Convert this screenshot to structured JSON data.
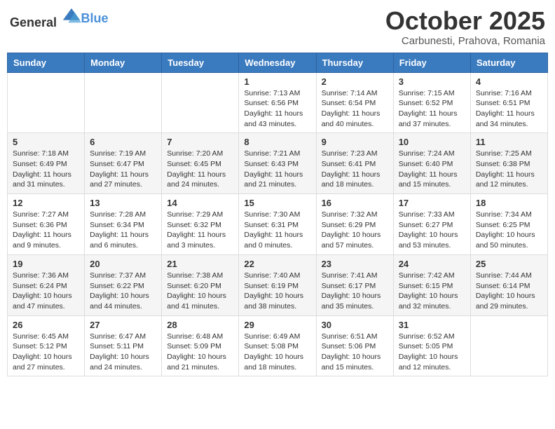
{
  "header": {
    "logo_general": "General",
    "logo_blue": "Blue",
    "month": "October 2025",
    "location": "Carbunesti, Prahova, Romania"
  },
  "days_of_week": [
    "Sunday",
    "Monday",
    "Tuesday",
    "Wednesday",
    "Thursday",
    "Friday",
    "Saturday"
  ],
  "weeks": [
    [
      {
        "day": "",
        "info": ""
      },
      {
        "day": "",
        "info": ""
      },
      {
        "day": "",
        "info": ""
      },
      {
        "day": "1",
        "info": "Sunrise: 7:13 AM\nSunset: 6:56 PM\nDaylight: 11 hours and 43 minutes."
      },
      {
        "day": "2",
        "info": "Sunrise: 7:14 AM\nSunset: 6:54 PM\nDaylight: 11 hours and 40 minutes."
      },
      {
        "day": "3",
        "info": "Sunrise: 7:15 AM\nSunset: 6:52 PM\nDaylight: 11 hours and 37 minutes."
      },
      {
        "day": "4",
        "info": "Sunrise: 7:16 AM\nSunset: 6:51 PM\nDaylight: 11 hours and 34 minutes."
      }
    ],
    [
      {
        "day": "5",
        "info": "Sunrise: 7:18 AM\nSunset: 6:49 PM\nDaylight: 11 hours and 31 minutes."
      },
      {
        "day": "6",
        "info": "Sunrise: 7:19 AM\nSunset: 6:47 PM\nDaylight: 11 hours and 27 minutes."
      },
      {
        "day": "7",
        "info": "Sunrise: 7:20 AM\nSunset: 6:45 PM\nDaylight: 11 hours and 24 minutes."
      },
      {
        "day": "8",
        "info": "Sunrise: 7:21 AM\nSunset: 6:43 PM\nDaylight: 11 hours and 21 minutes."
      },
      {
        "day": "9",
        "info": "Sunrise: 7:23 AM\nSunset: 6:41 PM\nDaylight: 11 hours and 18 minutes."
      },
      {
        "day": "10",
        "info": "Sunrise: 7:24 AM\nSunset: 6:40 PM\nDaylight: 11 hours and 15 minutes."
      },
      {
        "day": "11",
        "info": "Sunrise: 7:25 AM\nSunset: 6:38 PM\nDaylight: 11 hours and 12 minutes."
      }
    ],
    [
      {
        "day": "12",
        "info": "Sunrise: 7:27 AM\nSunset: 6:36 PM\nDaylight: 11 hours and 9 minutes."
      },
      {
        "day": "13",
        "info": "Sunrise: 7:28 AM\nSunset: 6:34 PM\nDaylight: 11 hours and 6 minutes."
      },
      {
        "day": "14",
        "info": "Sunrise: 7:29 AM\nSunset: 6:32 PM\nDaylight: 11 hours and 3 minutes."
      },
      {
        "day": "15",
        "info": "Sunrise: 7:30 AM\nSunset: 6:31 PM\nDaylight: 11 hours and 0 minutes."
      },
      {
        "day": "16",
        "info": "Sunrise: 7:32 AM\nSunset: 6:29 PM\nDaylight: 10 hours and 57 minutes."
      },
      {
        "day": "17",
        "info": "Sunrise: 7:33 AM\nSunset: 6:27 PM\nDaylight: 10 hours and 53 minutes."
      },
      {
        "day": "18",
        "info": "Sunrise: 7:34 AM\nSunset: 6:25 PM\nDaylight: 10 hours and 50 minutes."
      }
    ],
    [
      {
        "day": "19",
        "info": "Sunrise: 7:36 AM\nSunset: 6:24 PM\nDaylight: 10 hours and 47 minutes."
      },
      {
        "day": "20",
        "info": "Sunrise: 7:37 AM\nSunset: 6:22 PM\nDaylight: 10 hours and 44 minutes."
      },
      {
        "day": "21",
        "info": "Sunrise: 7:38 AM\nSunset: 6:20 PM\nDaylight: 10 hours and 41 minutes."
      },
      {
        "day": "22",
        "info": "Sunrise: 7:40 AM\nSunset: 6:19 PM\nDaylight: 10 hours and 38 minutes."
      },
      {
        "day": "23",
        "info": "Sunrise: 7:41 AM\nSunset: 6:17 PM\nDaylight: 10 hours and 35 minutes."
      },
      {
        "day": "24",
        "info": "Sunrise: 7:42 AM\nSunset: 6:15 PM\nDaylight: 10 hours and 32 minutes."
      },
      {
        "day": "25",
        "info": "Sunrise: 7:44 AM\nSunset: 6:14 PM\nDaylight: 10 hours and 29 minutes."
      }
    ],
    [
      {
        "day": "26",
        "info": "Sunrise: 6:45 AM\nSunset: 5:12 PM\nDaylight: 10 hours and 27 minutes."
      },
      {
        "day": "27",
        "info": "Sunrise: 6:47 AM\nSunset: 5:11 PM\nDaylight: 10 hours and 24 minutes."
      },
      {
        "day": "28",
        "info": "Sunrise: 6:48 AM\nSunset: 5:09 PM\nDaylight: 10 hours and 21 minutes."
      },
      {
        "day": "29",
        "info": "Sunrise: 6:49 AM\nSunset: 5:08 PM\nDaylight: 10 hours and 18 minutes."
      },
      {
        "day": "30",
        "info": "Sunrise: 6:51 AM\nSunset: 5:06 PM\nDaylight: 10 hours and 15 minutes."
      },
      {
        "day": "31",
        "info": "Sunrise: 6:52 AM\nSunset: 5:05 PM\nDaylight: 10 hours and 12 minutes."
      },
      {
        "day": "",
        "info": ""
      }
    ]
  ]
}
